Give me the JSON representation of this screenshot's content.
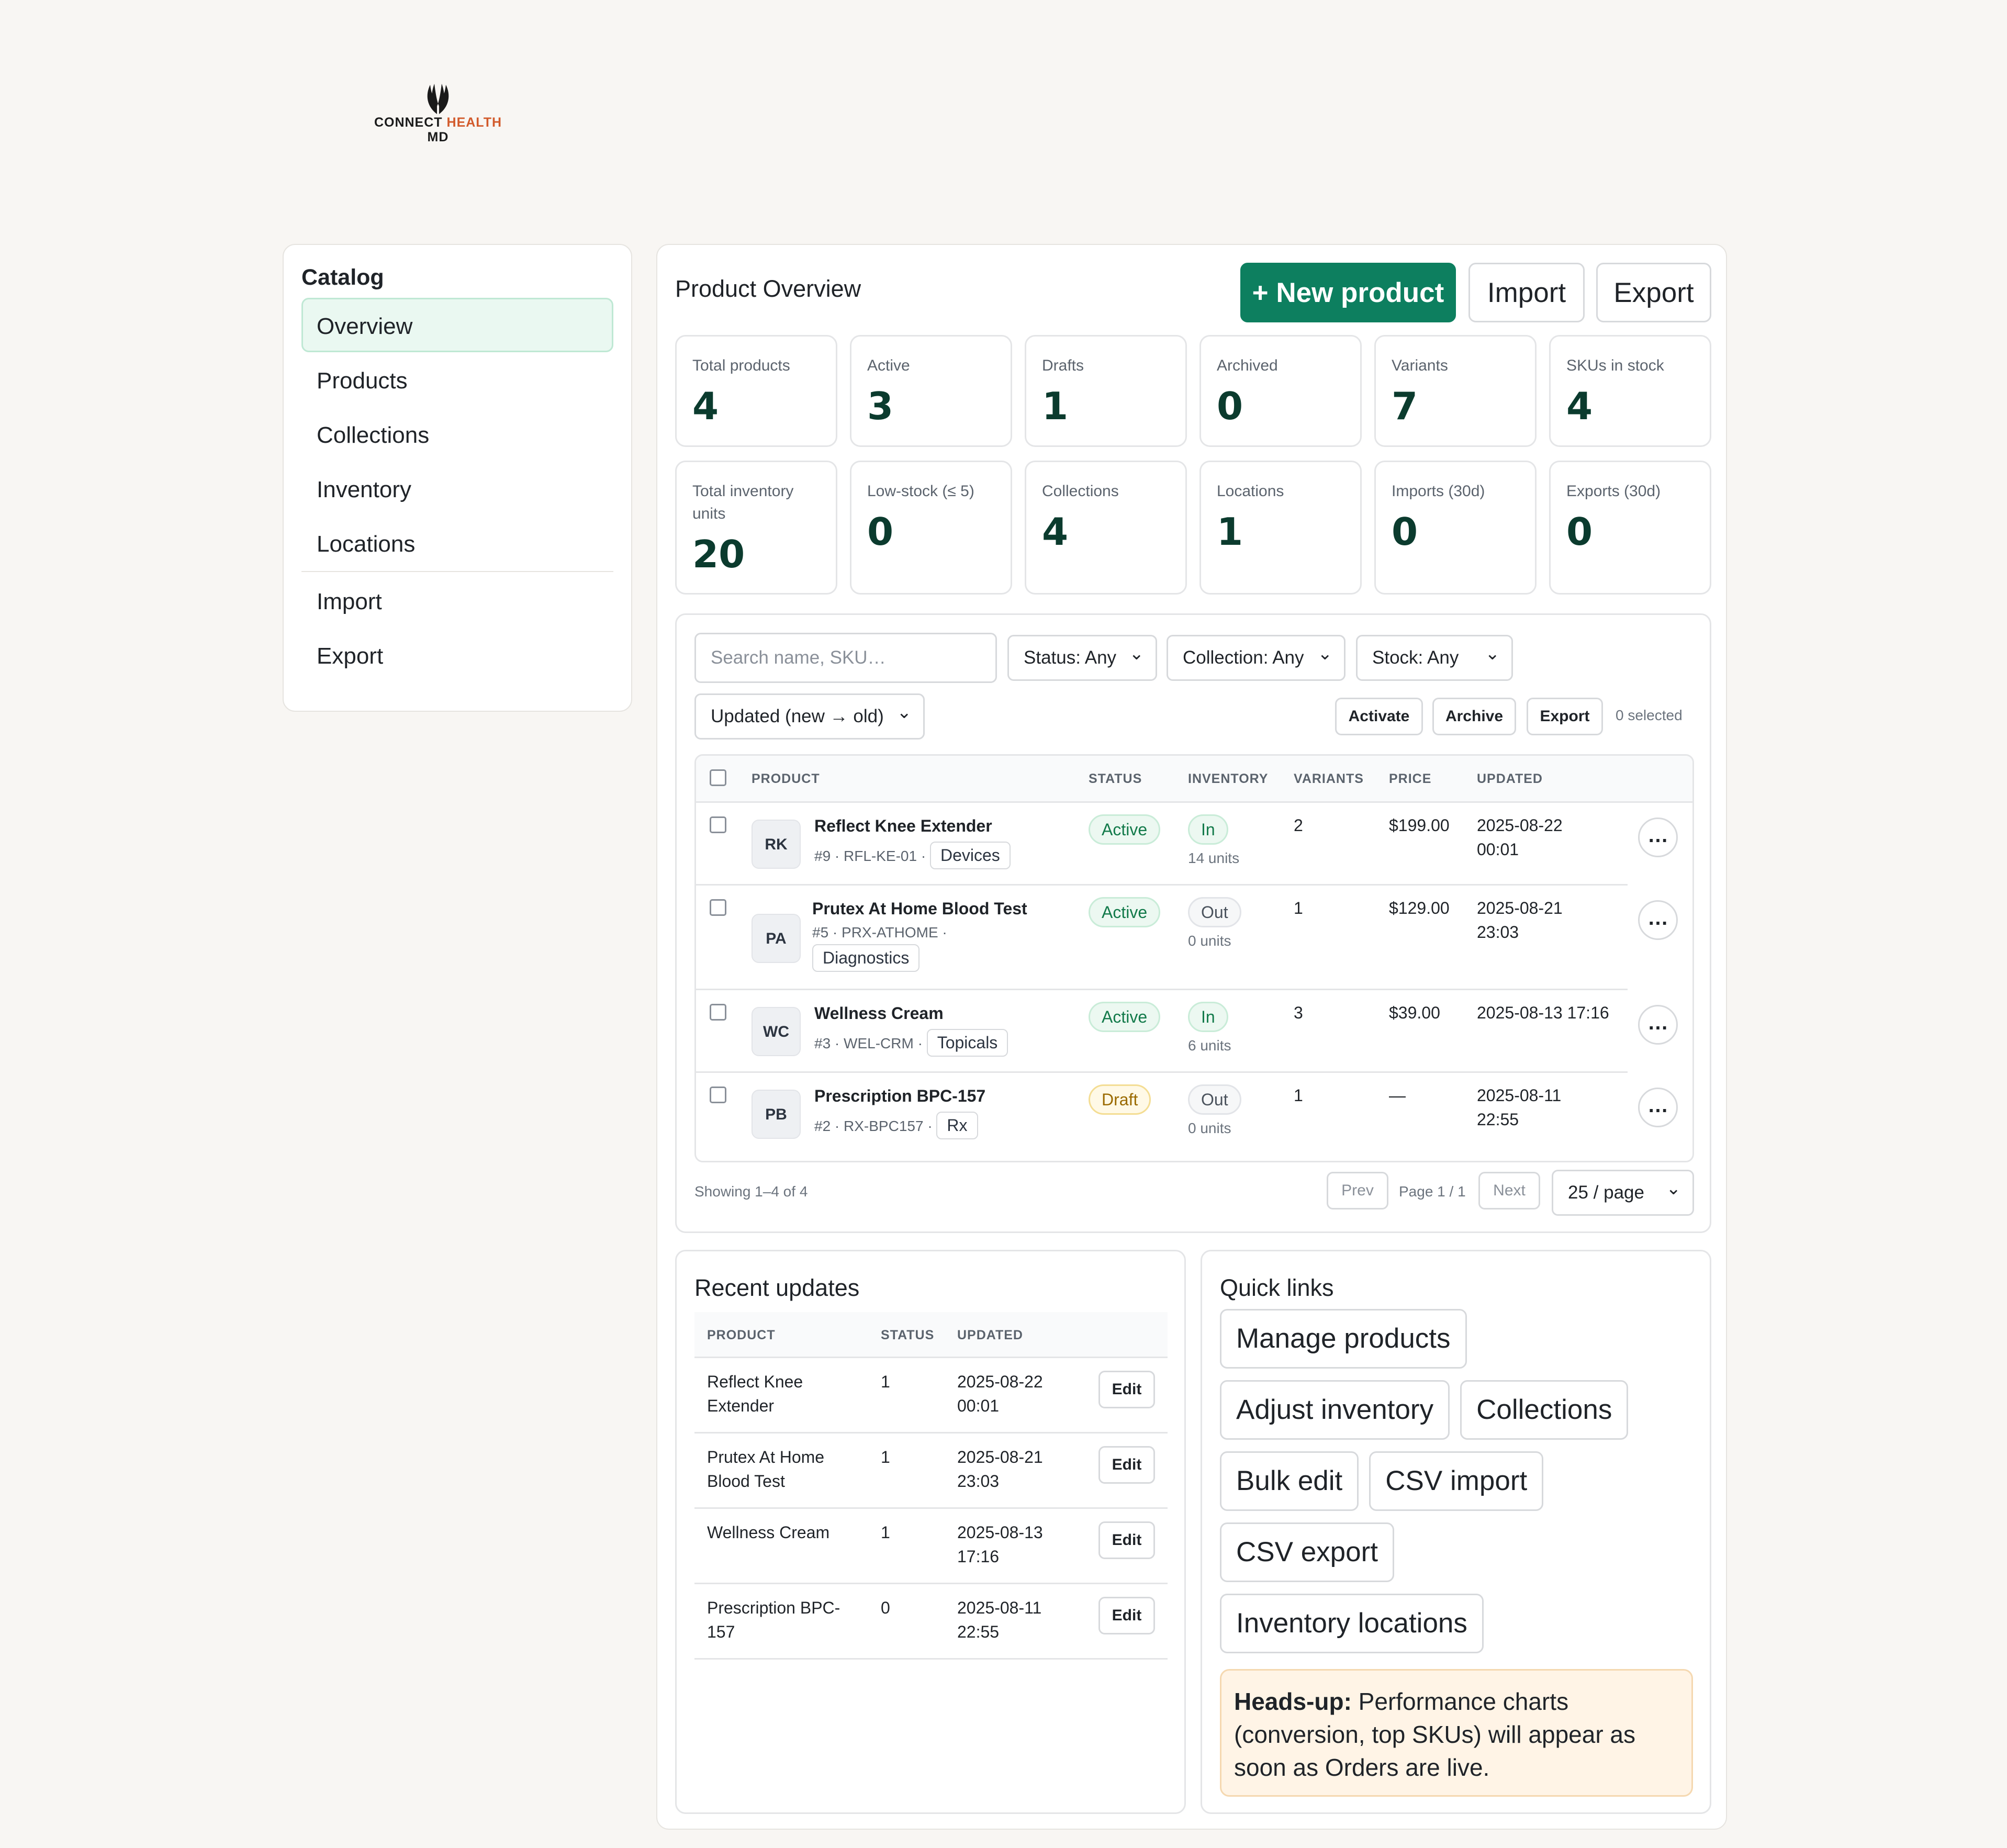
{
  "brand": {
    "word1": "CONNECT",
    "word2": "HEALTH",
    "word3": "MD",
    "accent_color": "#d25a2b"
  },
  "sidebar": {
    "title": "Catalog",
    "items": [
      {
        "label": "Overview"
      },
      {
        "label": "Products"
      },
      {
        "label": "Collections"
      },
      {
        "label": "Inventory"
      },
      {
        "label": "Locations"
      },
      {
        "label": "Import"
      },
      {
        "label": "Export"
      }
    ]
  },
  "header": {
    "title": "Product Overview",
    "new_label": "+ New product",
    "import_label": "Import",
    "export_label": "Export",
    "primary_color": "#0d7f5f"
  },
  "kpis": [
    {
      "label": "Total products",
      "value": "4"
    },
    {
      "label": "Active",
      "value": "3"
    },
    {
      "label": "Drafts",
      "value": "1"
    },
    {
      "label": "Archived",
      "value": "0"
    },
    {
      "label": "Variants",
      "value": "7"
    },
    {
      "label": "SKUs in stock",
      "value": "4"
    },
    {
      "label": "Total inventory units",
      "value": "20"
    },
    {
      "label": "Low-stock (≤ 5)",
      "value": "0"
    },
    {
      "label": "Collections",
      "value": "4"
    },
    {
      "label": "Locations",
      "value": "1"
    },
    {
      "label": "Imports (30d)",
      "value": "0"
    },
    {
      "label": "Exports (30d)",
      "value": "0"
    }
  ],
  "filters": {
    "search_placeholder": "Search name, SKU…",
    "status": "Status: Any",
    "collection": "Collection: Any",
    "stock": "Stock: Any",
    "sort": "Updated (new → old)",
    "activate_label": "Activate",
    "archive_label": "Archive",
    "export_label": "Export",
    "selected_text": "0 selected"
  },
  "table": {
    "columns": [
      "PRODUCT",
      "STATUS",
      "INVENTORY",
      "VARIANTS",
      "PRICE",
      "UPDATED"
    ],
    "rows": [
      {
        "initials": "RK",
        "name": "Reflect Knee Extender",
        "sub": "#9 · RFL-KE-01 ·",
        "tag": "Devices",
        "status": "Active",
        "stock": "In",
        "units": "14 units",
        "variants": "2",
        "price": "$199.00",
        "updated": "2025-08-22 00:01"
      },
      {
        "initials": "PA",
        "name": "Prutex At Home Blood Test",
        "sub": "#5 · PRX-ATHOME ·",
        "tag": "Diagnostics",
        "status": "Active",
        "stock": "Out",
        "units": "0 units",
        "variants": "1",
        "price": "$129.00",
        "updated": "2025-08-21 23:03"
      },
      {
        "initials": "WC",
        "name": "Wellness Cream",
        "sub": "#3 · WEL-CRM ·",
        "tag": "Topicals",
        "status": "Active",
        "stock": "In",
        "units": "6 units",
        "variants": "3",
        "price": "$39.00",
        "updated": "2025-08-13 17:16"
      },
      {
        "initials": "PB",
        "name": "Prescription BPC-157",
        "sub": "#2 · RX-BPC157 ·",
        "tag": "Rx",
        "status": "Draft",
        "stock": "Out",
        "units": "0 units",
        "variants": "1",
        "price": "—",
        "updated": "2025-08-11 22:55"
      }
    ],
    "more_label": "…"
  },
  "pagination": {
    "showing": "Showing 1–4 of 4",
    "prev": "Prev",
    "page": "Page 1 / 1",
    "next": "Next",
    "per_page": "25 / page"
  },
  "recent": {
    "title": "Recent updates",
    "columns": [
      "PRODUCT",
      "STATUS",
      "UPDATED"
    ],
    "edit_label": "Edit",
    "rows": [
      {
        "product": "Reflect Knee Extender",
        "status": "1",
        "updated": "2025-08-22 00:01"
      },
      {
        "product": "Prutex At Home Blood Test",
        "status": "1",
        "updated": "2025-08-21 23:03"
      },
      {
        "product": "Wellness Cream",
        "status": "1",
        "updated": "2025-08-13 17:16"
      },
      {
        "product": "Prescription BPC-157",
        "status": "0",
        "updated": "2025-08-11 22:55"
      }
    ]
  },
  "quick": {
    "title": "Quick links",
    "links": [
      "Manage products",
      "Adjust inventory",
      "Collections",
      "Bulk edit",
      "CSV import",
      "CSV export",
      "Inventory locations"
    ],
    "notice_bold": "Heads-up:",
    "notice_text": " Performance charts (conversion, top SKUs) will appear as soon as Orders are live."
  }
}
